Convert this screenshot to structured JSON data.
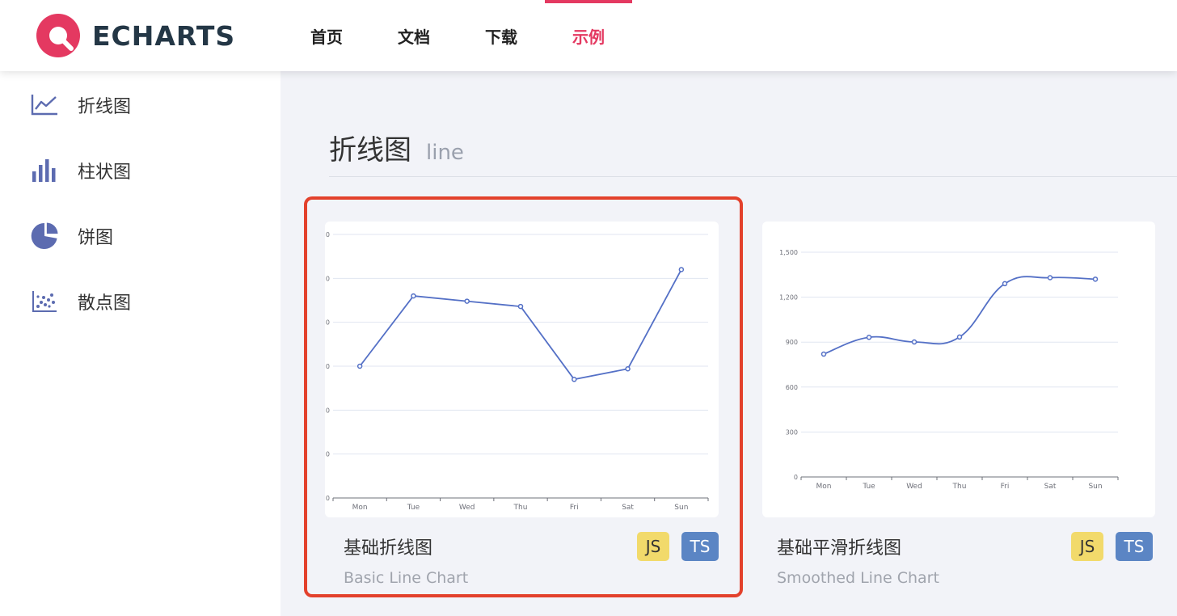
{
  "header": {
    "logo_text": "ECHARTS",
    "nav": [
      {
        "label": "首页"
      },
      {
        "label": "文档"
      },
      {
        "label": "下载"
      },
      {
        "label": "示例",
        "active": true
      }
    ],
    "accent_color": "#e43961"
  },
  "sidebar": {
    "items": [
      {
        "label": "折线图",
        "icon": "line-chart-icon"
      },
      {
        "label": "柱状图",
        "icon": "bar-chart-icon"
      },
      {
        "label": "饼图",
        "icon": "pie-chart-icon"
      },
      {
        "label": "散点图",
        "icon": "scatter-chart-icon"
      }
    ],
    "icon_color": "#5c6bb0"
  },
  "main": {
    "section_title": "折线图",
    "section_subtitle": "line",
    "cards": [
      {
        "name": "基础折线图",
        "subtitle": "Basic Line Chart",
        "badges": [
          "JS",
          "TS"
        ],
        "selected": true
      },
      {
        "name": "基础平滑折线图",
        "subtitle": "Smoothed Line Chart",
        "badges": [
          "JS",
          "TS"
        ],
        "selected": false
      }
    ]
  },
  "chart_data": [
    {
      "type": "line",
      "categories": [
        "Mon",
        "Tue",
        "Wed",
        "Thu",
        "Fri",
        "Sat",
        "Sun"
      ],
      "series": [
        {
          "values": [
            150,
            230,
            224,
            218,
            135,
            147,
            260
          ]
        }
      ],
      "ylim": [
        0,
        300
      ],
      "y_ticks": [
        0,
        50,
        100,
        150,
        200,
        250,
        300
      ],
      "y_tick_labels": [
        "0",
        "0",
        "0",
        "0",
        "0",
        "0",
        "0"
      ],
      "smooth": false,
      "grid": true,
      "color": "#5470c6"
    },
    {
      "type": "line",
      "categories": [
        "Mon",
        "Tue",
        "Wed",
        "Thu",
        "Fri",
        "Sat",
        "Sun"
      ],
      "series": [
        {
          "values": [
            820,
            932,
            901,
            934,
            1290,
            1330,
            1320
          ]
        }
      ],
      "ylim": [
        0,
        1500
      ],
      "y_ticks": [
        0,
        300,
        600,
        900,
        1200,
        1500
      ],
      "y_tick_labels": [
        "0",
        "300",
        "600",
        "900",
        "1,200",
        "1,500"
      ],
      "smooth": true,
      "grid": true,
      "color": "#5470c6"
    }
  ]
}
